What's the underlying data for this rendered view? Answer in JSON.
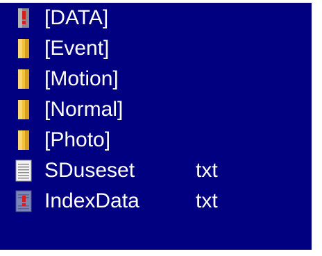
{
  "file_list": {
    "items": [
      {
        "name": "[DATA]",
        "ext": "",
        "icon": "locked-folder-icon"
      },
      {
        "name": "[Event]",
        "ext": "",
        "icon": "folder-icon"
      },
      {
        "name": "[Motion]",
        "ext": "",
        "icon": "folder-icon"
      },
      {
        "name": "[Normal]",
        "ext": "",
        "icon": "folder-icon"
      },
      {
        "name": "[Photo]",
        "ext": "",
        "icon": "folder-icon"
      },
      {
        "name": "SDuseset",
        "ext": "txt",
        "icon": "text-file-icon"
      },
      {
        "name": "IndexData",
        "ext": "txt",
        "icon": "locked-file-icon"
      }
    ]
  },
  "colors": {
    "background": "#000080",
    "text": "#ffffff",
    "folder": "#f3c13a",
    "lock": "#d02020"
  }
}
